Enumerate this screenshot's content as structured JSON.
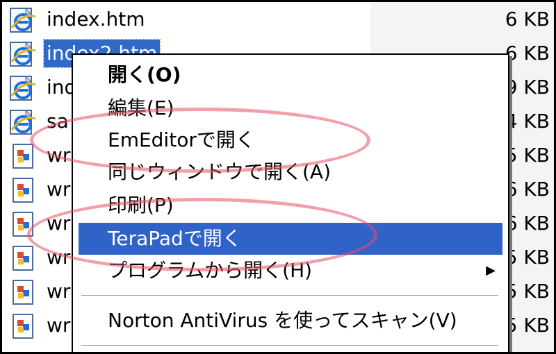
{
  "files": [
    {
      "name": "index.htm",
      "size": "6 KB",
      "icon": "ie-html-icon",
      "selected": false
    },
    {
      "name": "index2.htm",
      "size": "6 KB",
      "icon": "ie-html-icon",
      "selected": true
    },
    {
      "name": "ind",
      "size": "9 KB",
      "icon": "ie-html-icon",
      "selected": false
    },
    {
      "name": "sa",
      "size": "4 KB",
      "icon": "ie-html-icon",
      "selected": false
    },
    {
      "name": "wr",
      "size": "5 KB",
      "icon": "doc-icon",
      "selected": false
    },
    {
      "name": "wr",
      "size": "6 KB",
      "icon": "doc-icon",
      "selected": false
    },
    {
      "name": "wr",
      "size": "6 KB",
      "icon": "doc-icon",
      "selected": false
    },
    {
      "name": "wr",
      "size": "5 KB",
      "icon": "doc-icon",
      "selected": false
    },
    {
      "name": "wr",
      "size": "5 KB",
      "icon": "doc-icon",
      "selected": false
    },
    {
      "name": "wr",
      "size": "5 KB",
      "icon": "doc-icon",
      "selected": false
    }
  ],
  "context_menu": {
    "items": [
      {
        "label": "開く(O)",
        "bold": true
      },
      {
        "label": "編集(E)"
      },
      {
        "label": "EmEditorで開く"
      },
      {
        "label": "同じウィンドウで開く(A)"
      },
      {
        "label": "印刷(P)"
      },
      {
        "label": "TeraPadで開く",
        "highlighted": true
      },
      {
        "label": "プログラムから開く(H)",
        "submenu": true
      },
      {
        "label": "Norton AntiVirus を使ってスキャン(V)"
      }
    ],
    "submenu_arrow": "▶"
  },
  "colors": {
    "selection": "#3169c6",
    "menu_highlight": "#2f63c8",
    "annotation": "#e65064"
  }
}
